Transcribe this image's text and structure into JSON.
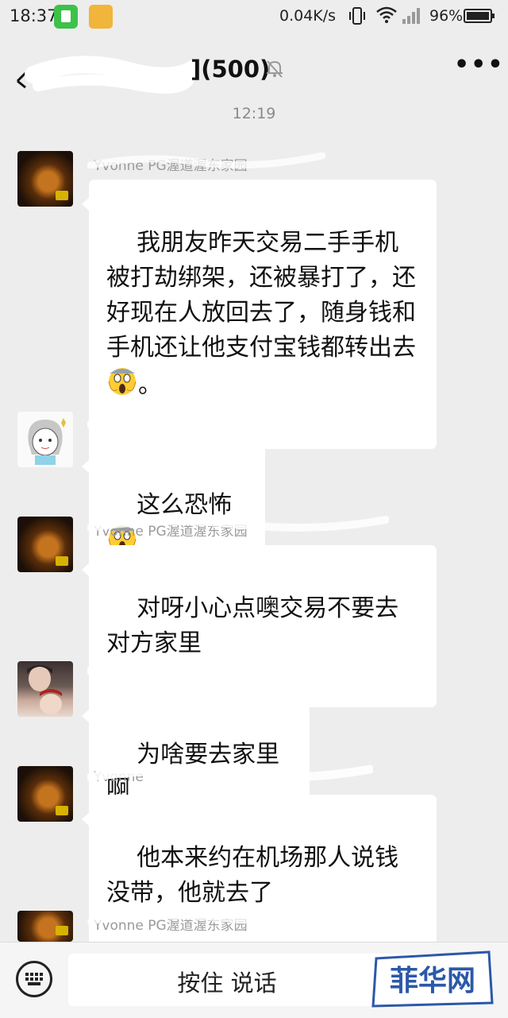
{
  "status_bar": {
    "time": "18:37",
    "net_speed": "0.04K/s",
    "battery": "96%",
    "icons": [
      "app-notification-icon",
      "folder-icon",
      "vibrate-icon",
      "wifi-icon",
      "signal-icon",
      "battery-icon"
    ]
  },
  "header": {
    "title": "](500)",
    "icons": [
      "back-icon",
      "mute-icon",
      "more-icon"
    ]
  },
  "chat": {
    "timestamp": "12:19",
    "messages": [
      {
        "sender": "Yvonne  PG渥道渥东家园",
        "text": "我朋友昨天交易二手手机被打劫绑架，还被暴打了，还好现在人放回去了，随身钱和手机还让他支付宝钱都转出去",
        "suffix": "。",
        "emoji": "scream-emoji"
      },
      {
        "sender": "",
        "text": "这么恐怖",
        "suffix": "",
        "emoji": "scream-emoji"
      },
      {
        "sender": "Yvonne  PG渥道渥东家园",
        "text": "对呀小心点噢交易不要去对方家里"
      },
      {
        "sender": "",
        "text": "为啥要去家里啊"
      },
      {
        "sender": "Yvonne",
        "text": "他本来约在机场那人说钱没带，他就去了"
      },
      {
        "sender": "Yvonne  PG渥道渥东家园",
        "text": ""
      }
    ]
  },
  "bottom_bar": {
    "hold_to_talk": "按住 说话",
    "watermark": "菲华网",
    "icons": [
      "keyboard-icon"
    ]
  },
  "colors": {
    "background": "#ededed",
    "bubble": "#ffffff",
    "watermark_blue": "#2c58a8"
  }
}
